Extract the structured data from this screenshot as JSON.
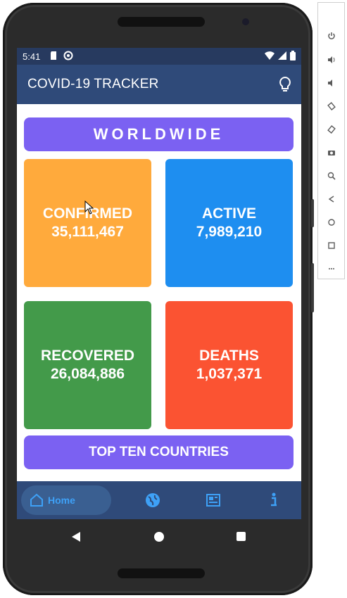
{
  "status_bar": {
    "time": "5:41",
    "left_icons": [
      "sd-card-icon",
      "sync-icon"
    ],
    "right_icons": [
      "wifi-icon",
      "signal-icon",
      "battery-icon"
    ]
  },
  "app_bar": {
    "title": "COVID-19 TRACKER",
    "action_icon": "lightbulb-icon"
  },
  "banner": {
    "label": "WORLDWIDE"
  },
  "stats": [
    {
      "label": "CONFIRMED",
      "value": "35,111,467",
      "color": "#ffaa3c"
    },
    {
      "label": "ACTIVE",
      "value": "7,989,210",
      "color": "#1e8ef0"
    },
    {
      "label": "RECOVERED",
      "value": "26,084,886",
      "color": "#439a4a"
    },
    {
      "label": "DEATHS",
      "value": "1,037,371",
      "color": "#fb5332"
    }
  ],
  "top_ten_button": {
    "label": "TOP TEN COUNTRIES"
  },
  "bottom_nav": {
    "items": [
      {
        "label": "Home",
        "icon": "home-icon",
        "selected": true
      },
      {
        "label": "",
        "icon": "globe-icon",
        "selected": false
      },
      {
        "label": "",
        "icon": "news-icon",
        "selected": false
      },
      {
        "label": "",
        "icon": "info-icon",
        "selected": false
      }
    ]
  },
  "colors": {
    "app_bar": "#2f4a79",
    "accent_purple": "#7b61f2",
    "nav_selected": "#3ea1f7"
  },
  "emulator_toolbar": {
    "icons": [
      "power-icon",
      "volume-up-icon",
      "volume-down-icon",
      "rotate-left-icon",
      "rotate-right-icon",
      "camera-icon",
      "zoom-icon",
      "back-icon",
      "home-icon",
      "overview-icon",
      "more-icon"
    ]
  }
}
